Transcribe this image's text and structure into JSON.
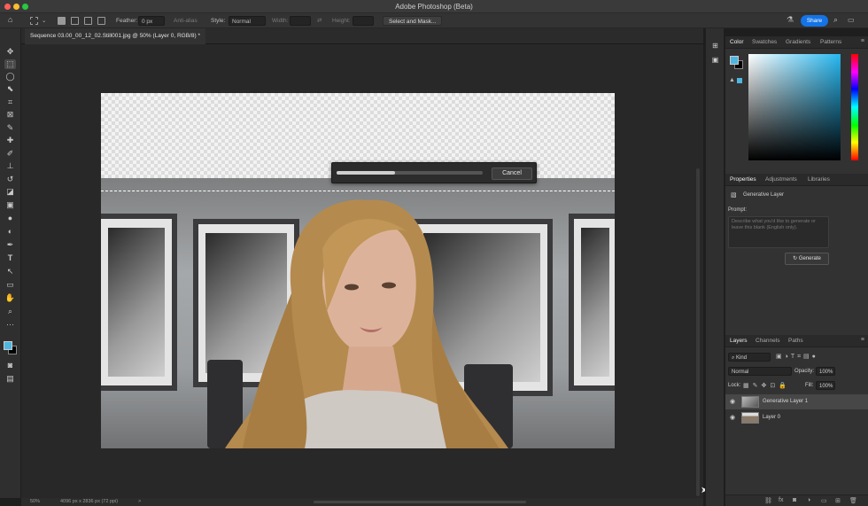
{
  "window": {
    "title": "Adobe Photoshop (Beta)"
  },
  "options_bar": {
    "feather_label": "Feather:",
    "feather_value": "0 px",
    "anti_alias_label": "Anti-alias",
    "style_label": "Style:",
    "style_value": "Normal",
    "width_label": "Width:",
    "height_label": "Height:",
    "select_mask_label": "Select and Mask...",
    "share_label": "Share"
  },
  "document_tab": {
    "label": "Sequence 03.00_00_12_02.Still001.jpg @ 50% (Layer 0, RGB/8) *"
  },
  "progress": {
    "fraction": 0.4,
    "cancel_label": "Cancel"
  },
  "status_bar": {
    "zoom": "50%",
    "doc_size": "4096 px x 2836 px (72 ppi)",
    "chevron": ">"
  },
  "color_panel": {
    "tabs": [
      "Color",
      "Swatches",
      "Gradients",
      "Patterns"
    ],
    "foreground": "#4fb6e0",
    "background": "#000000"
  },
  "properties_panel": {
    "tabs": [
      "Properties",
      "Adjustments",
      "Libraries"
    ],
    "layer_type": "Generative Layer",
    "prompt_label": "Prompt:",
    "prompt_placeholder": "Describe what you'd like to generate or leave this blank (English only).",
    "generate_label": "Generate"
  },
  "layers_panel": {
    "tabs": [
      "Layers",
      "Channels",
      "Paths"
    ],
    "filter_value": "Kind",
    "blend_mode": "Normal",
    "opacity_label": "Opacity:",
    "opacity_value": "100%",
    "lock_label": "Lock:",
    "fill_label": "Fill:",
    "fill_value": "100%",
    "layers": [
      {
        "name": "Generative Layer 1"
      },
      {
        "name": "Layer 0"
      }
    ]
  },
  "colors": {
    "accent": "#1473e6"
  }
}
